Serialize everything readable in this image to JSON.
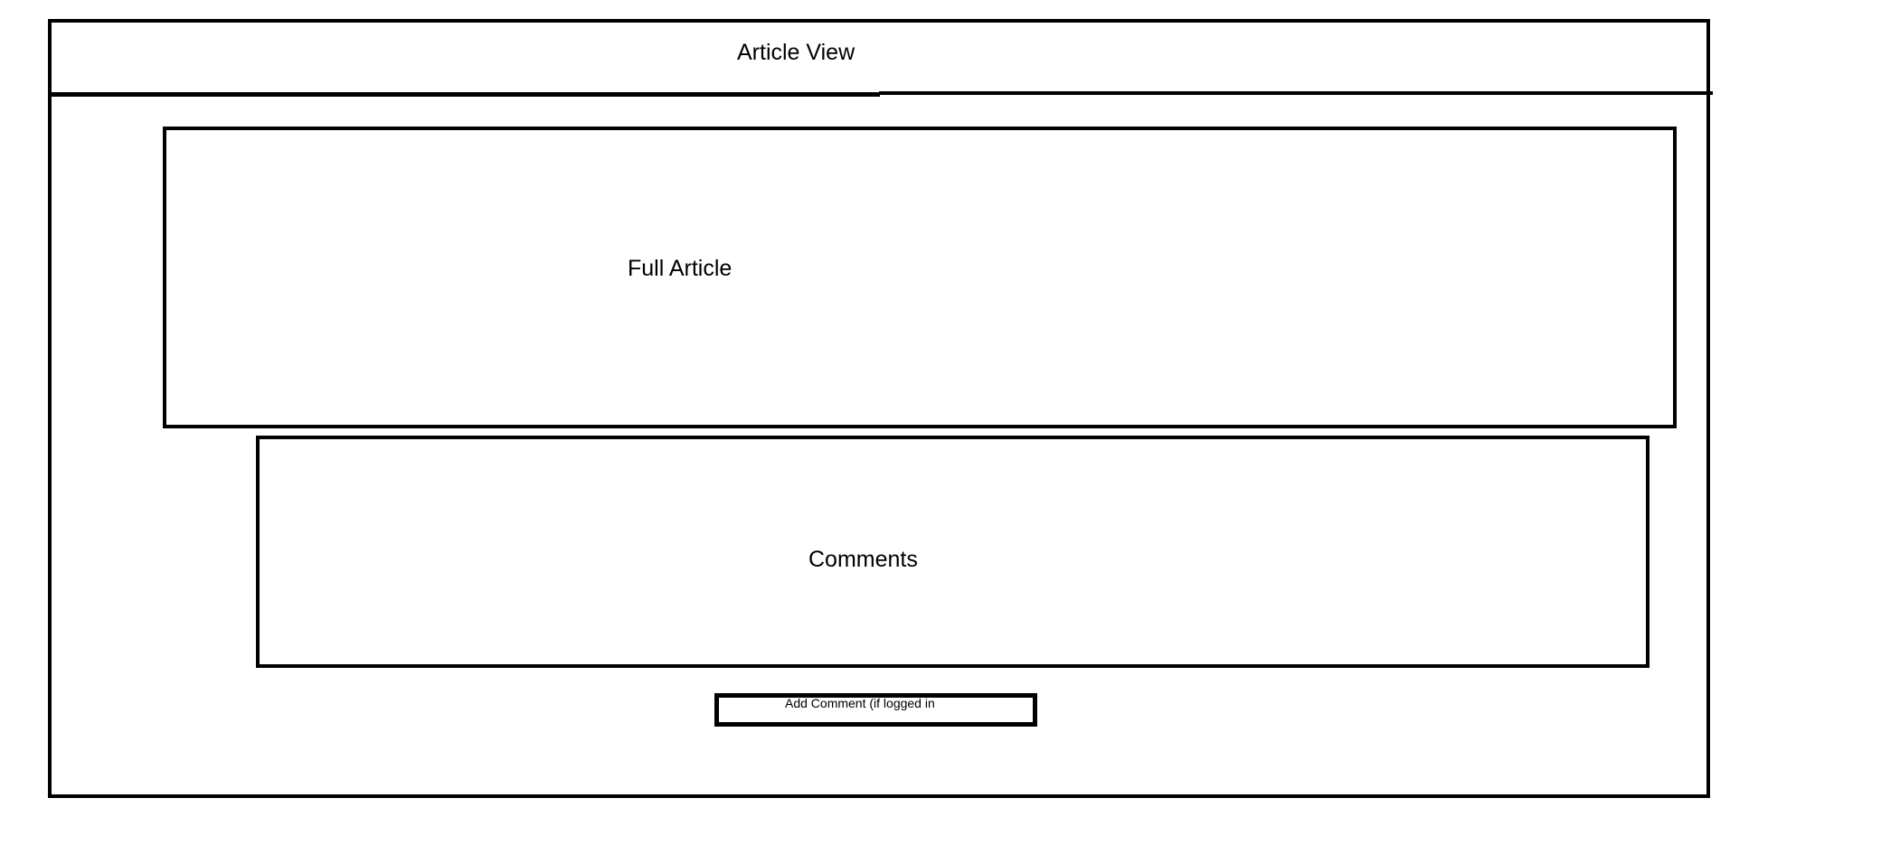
{
  "header": {
    "title": "Article View"
  },
  "article": {
    "label": "Full Article"
  },
  "comments": {
    "label": "Comments"
  },
  "add_comment": {
    "label": "Add Comment (if logged in"
  }
}
